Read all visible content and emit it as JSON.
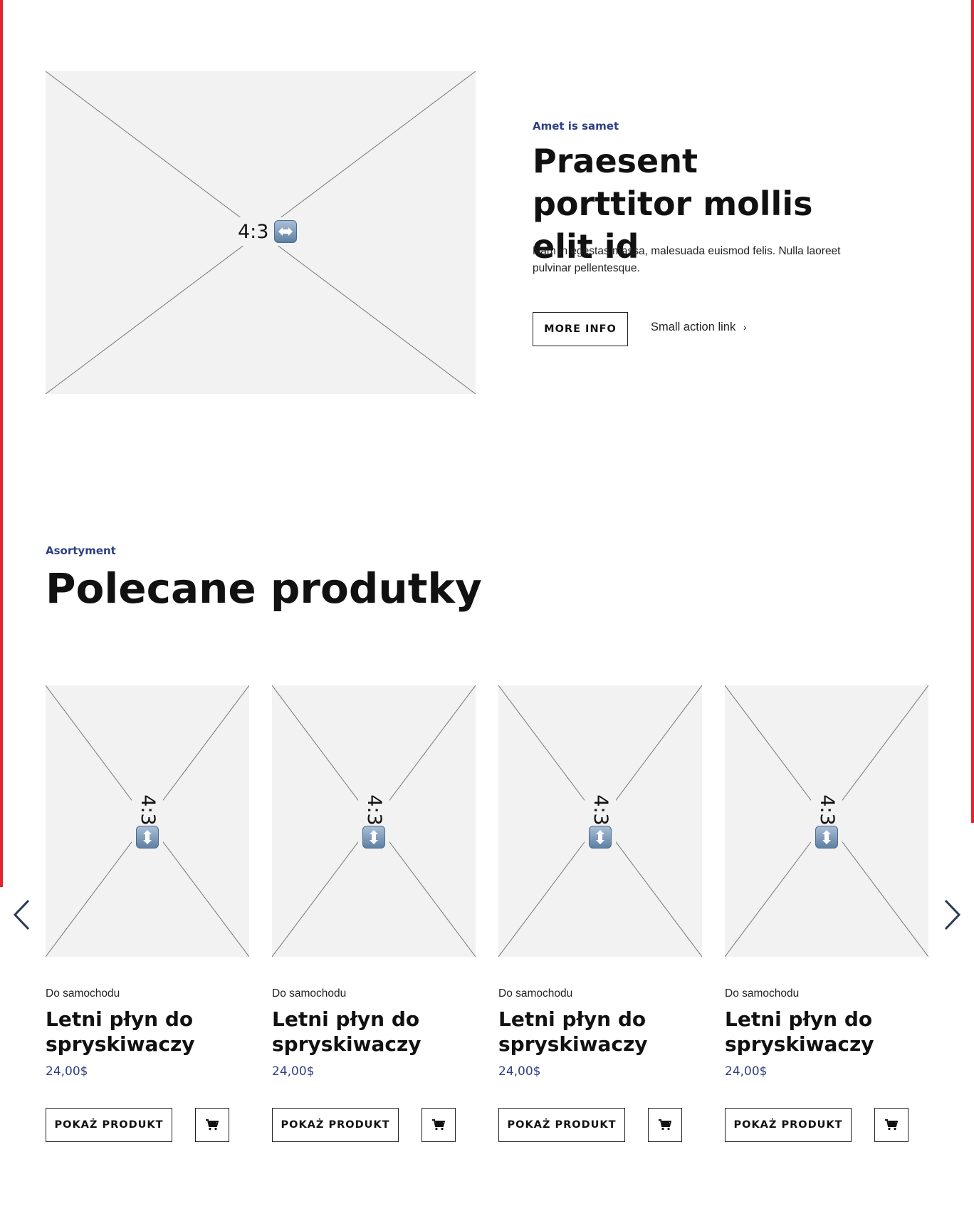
{
  "hero": {
    "image_label": "4:3",
    "image_icon": "left-right-arrow-icon",
    "eyebrow": "Amet is samet",
    "title": "Praesent porttitor mollis elit id",
    "text": "Nam in egestas massa, malesuada euismod felis. Nulla laoreet pulvinar pellentesque.",
    "more_info_label": "MORE INFO",
    "small_link_label": "Small action link",
    "small_link_icon": "chevron-right-icon"
  },
  "products_section": {
    "eyebrow": "Asortyment",
    "title": "Polecane produtky",
    "prev_icon": "chevron-left-icon",
    "next_icon": "chevron-right-icon",
    "cards": [
      {
        "image_label": "4:3",
        "image_icon": "up-down-arrow-icon",
        "category": "Do samochodu",
        "title": "Letni płyn do spryskiwaczy",
        "price": "24,00$",
        "button_label": "POKAŻ PRODUKT",
        "cart_icon": "cart-icon"
      },
      {
        "image_label": "4:3",
        "image_icon": "up-down-arrow-icon",
        "category": "Do samochodu",
        "title": "Letni płyn do spryskiwaczy",
        "price": "24,00$",
        "button_label": "POKAŻ PRODUKT",
        "cart_icon": "cart-icon"
      },
      {
        "image_label": "4:3",
        "image_icon": "up-down-arrow-icon",
        "category": "Do samochodu",
        "title": "Letni płyn do spryskiwaczy",
        "price": "24,00$",
        "button_label": "POKAŻ PRODUKT",
        "cart_icon": "cart-icon"
      },
      {
        "image_label": "4:3",
        "image_icon": "up-down-arrow-icon",
        "category": "Do samochodu",
        "title": "Letni płyn do spryskiwaczy",
        "price": "24,00$",
        "button_label": "POKAŻ PRODUKT",
        "cart_icon": "cart-icon"
      }
    ]
  },
  "colors": {
    "accent": "#2e3f85",
    "placeholder_bg": "#f2f2f2",
    "guide_line": "#e0262b"
  }
}
